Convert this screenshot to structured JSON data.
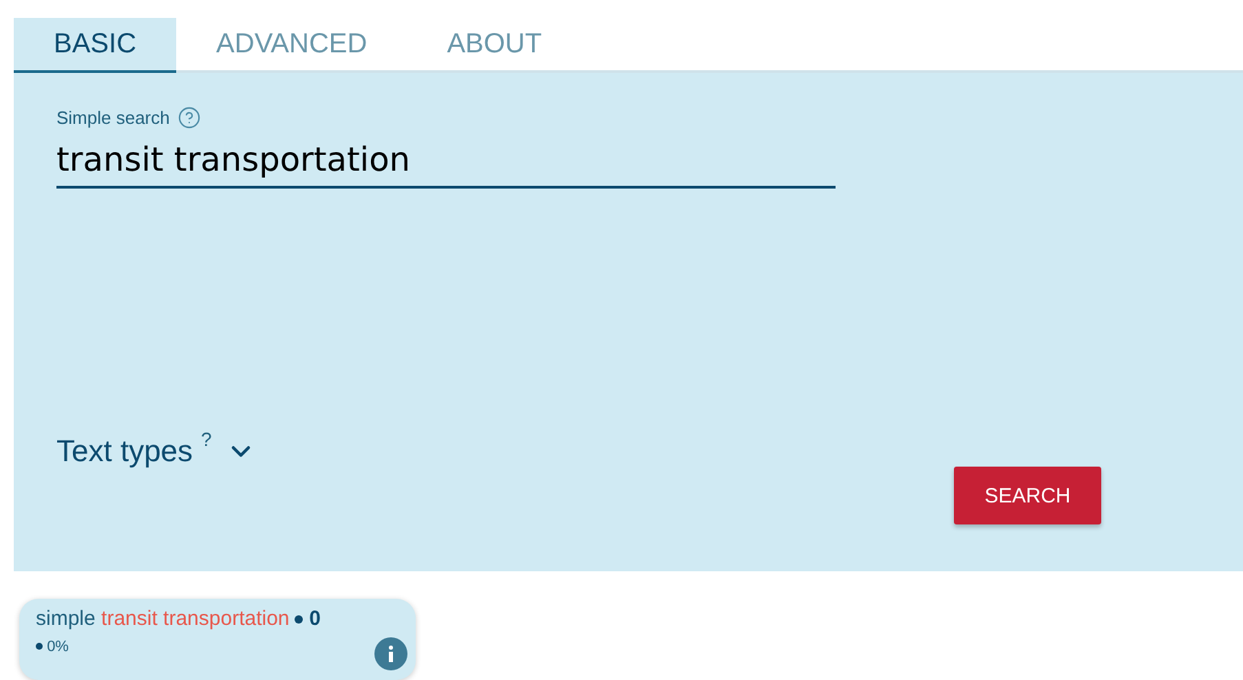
{
  "tabs": [
    {
      "label": "BASIC",
      "selected": true
    },
    {
      "label": "ADVANCED",
      "selected": false
    },
    {
      "label": "ABOUT",
      "selected": false
    }
  ],
  "search": {
    "label": "Simple search",
    "value": "transit transportation"
  },
  "text_types": {
    "label": "Text types",
    "help": "?",
    "expanded": false
  },
  "search_button": "SEARCH",
  "result": {
    "type": "simple",
    "query": "transit transportation",
    "count": "0",
    "percent": "0%"
  }
}
